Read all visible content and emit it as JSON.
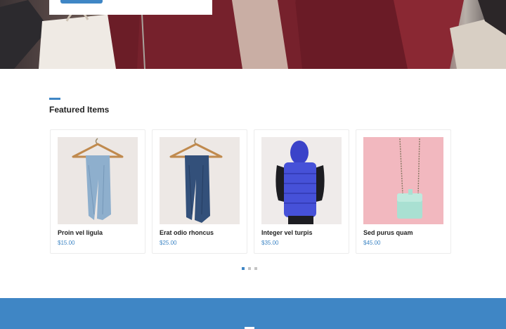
{
  "hero": {
    "image": "shopping-woman-with-bags",
    "button_color": "#3f86c5"
  },
  "featured": {
    "title": "Featured Items",
    "accent_color": "#3f86c5",
    "items": [
      {
        "name": "Proin vel ligula",
        "price": "$15.00",
        "image": "light-jeans-on-hanger"
      },
      {
        "name": "Erat odio rhoncus",
        "price": "$25.00",
        "image": "dark-jeans-on-hanger"
      },
      {
        "name": "Integer vel turpis",
        "price": "$35.00",
        "image": "blue-puffer-vest"
      },
      {
        "name": "Sed purus quam",
        "price": "$45.00",
        "image": "mint-bag-on-pink"
      }
    ],
    "pager": {
      "count": 3,
      "active": 1
    }
  },
  "band": {
    "color": "#3f86c5"
  }
}
